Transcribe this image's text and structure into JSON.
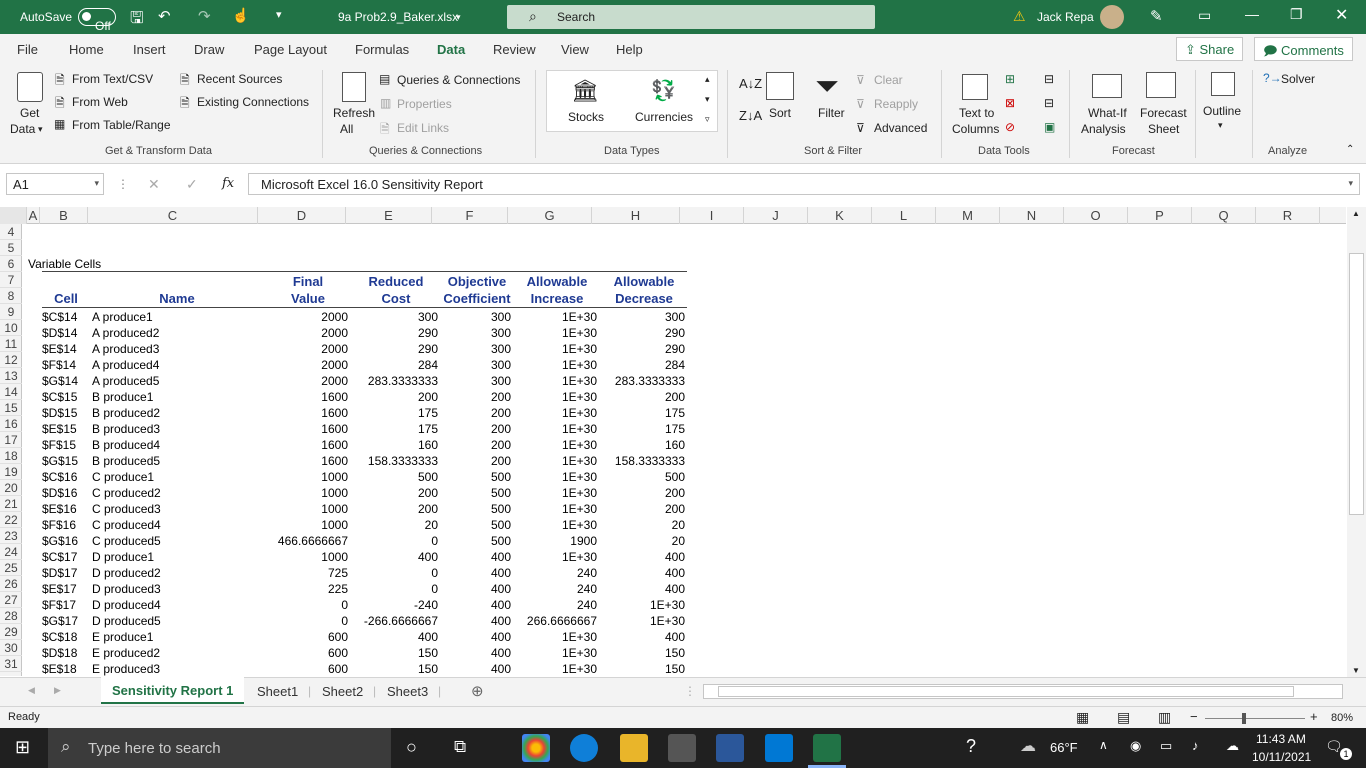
{
  "titlebar": {
    "autosave_label": "AutoSave",
    "autosave_state": "Off",
    "filename": "9a Prob2.9_Baker.xlsx",
    "search_placeholder": "Search",
    "user": "Jack Repa"
  },
  "tabs": [
    "File",
    "Home",
    "Insert",
    "Draw",
    "Page Layout",
    "Formulas",
    "Data",
    "Review",
    "View",
    "Help"
  ],
  "active_tab": "Data",
  "share_label": "Share",
  "comments_label": "Comments",
  "ribbon": {
    "get_data": "Get",
    "get_data2": "Data",
    "from_text": "From Text/CSV",
    "from_web": "From Web",
    "from_table": "From Table/Range",
    "recent_sources": "Recent Sources",
    "existing_connections": "Existing Connections",
    "group_get": "Get & Transform Data",
    "refresh": "Refresh",
    "refresh_all": "All",
    "queries_connections": "Queries & Connections",
    "properties": "Properties",
    "edit_links": "Edit Links",
    "group_queries": "Queries & Connections",
    "stocks": "Stocks",
    "currencies": "Currencies",
    "group_datatypes": "Data Types",
    "sort": "Sort",
    "filter": "Filter",
    "clear": "Clear",
    "reapply": "Reapply",
    "advanced": "Advanced",
    "group_sort": "Sort & Filter",
    "text_to": "Text to",
    "columns": "Columns",
    "group_datatools": "Data Tools",
    "whatif": "What-If",
    "analysis": "Analysis",
    "forecast": "Forecast",
    "sheet": "Sheet",
    "group_forecast": "Forecast",
    "outline": "Outline",
    "solver": "Solver",
    "group_analyze": "Analyze"
  },
  "formula_bar": {
    "name_box": "A1",
    "fx": "fx",
    "formula": "Microsoft Excel 16.0 Sensitivity Report"
  },
  "columns": [
    "A",
    "B",
    "C",
    "D",
    "E",
    "F",
    "G",
    "H",
    "I",
    "J",
    "K",
    "L",
    "M",
    "N",
    "O",
    "P",
    "Q",
    "R"
  ],
  "rows": [
    "4",
    "5",
    "6",
    "7",
    "8",
    "9",
    "10",
    "11",
    "12",
    "13",
    "14",
    "15",
    "16",
    "17",
    "18",
    "19",
    "20",
    "21",
    "22",
    "23",
    "24",
    "25",
    "26",
    "27",
    "28",
    "29",
    "30",
    "31"
  ],
  "section_label": "Variable Cells",
  "headers": {
    "cell": "Cell",
    "name": "Name",
    "final1": "Final",
    "final2": "Value",
    "reduced1": "Reduced",
    "reduced2": "Cost",
    "objective1": "Objective",
    "objective2": "Coefficient",
    "allow_inc1": "Allowable",
    "allow_inc2": "Increase",
    "allow_dec1": "Allowable",
    "allow_dec2": "Decrease"
  },
  "table": [
    [
      "$C$14",
      "A produce1",
      "2000",
      "300",
      "300",
      "1E+30",
      "300"
    ],
    [
      "$D$14",
      "A produced2",
      "2000",
      "290",
      "300",
      "1E+30",
      "290"
    ],
    [
      "$E$14",
      "A produced3",
      "2000",
      "290",
      "300",
      "1E+30",
      "290"
    ],
    [
      "$F$14",
      "A produced4",
      "2000",
      "284",
      "300",
      "1E+30",
      "284"
    ],
    [
      "$G$14",
      "A produced5",
      "2000",
      "283.3333333",
      "300",
      "1E+30",
      "283.3333333"
    ],
    [
      "$C$15",
      "B produce1",
      "1600",
      "200",
      "200",
      "1E+30",
      "200"
    ],
    [
      "$D$15",
      "B produced2",
      "1600",
      "175",
      "200",
      "1E+30",
      "175"
    ],
    [
      "$E$15",
      "B produced3",
      "1600",
      "175",
      "200",
      "1E+30",
      "175"
    ],
    [
      "$F$15",
      "B produced4",
      "1600",
      "160",
      "200",
      "1E+30",
      "160"
    ],
    [
      "$G$15",
      "B produced5",
      "1600",
      "158.3333333",
      "200",
      "1E+30",
      "158.3333333"
    ],
    [
      "$C$16",
      "C produce1",
      "1000",
      "500",
      "500",
      "1E+30",
      "500"
    ],
    [
      "$D$16",
      "C produced2",
      "1000",
      "200",
      "500",
      "1E+30",
      "200"
    ],
    [
      "$E$16",
      "C produced3",
      "1000",
      "200",
      "500",
      "1E+30",
      "200"
    ],
    [
      "$F$16",
      "C produced4",
      "1000",
      "20",
      "500",
      "1E+30",
      "20"
    ],
    [
      "$G$16",
      "C produced5",
      "466.6666667",
      "0",
      "500",
      "1900",
      "20"
    ],
    [
      "$C$17",
      "D produce1",
      "1000",
      "400",
      "400",
      "1E+30",
      "400"
    ],
    [
      "$D$17",
      "D produced2",
      "725",
      "0",
      "400",
      "240",
      "400"
    ],
    [
      "$E$17",
      "D produced3",
      "225",
      "0",
      "400",
      "240",
      "400"
    ],
    [
      "$F$17",
      "D produced4",
      "0",
      "-240",
      "400",
      "240",
      "1E+30"
    ],
    [
      "$G$17",
      "D produced5",
      "0",
      "-266.6666667",
      "400",
      "266.6666667",
      "1E+30"
    ],
    [
      "$C$18",
      "E produce1",
      "600",
      "400",
      "400",
      "1E+30",
      "400"
    ],
    [
      "$D$18",
      "E produced2",
      "600",
      "150",
      "400",
      "1E+30",
      "150"
    ],
    [
      "$E$18",
      "E produced3",
      "600",
      "150",
      "400",
      "1E+30",
      "150"
    ]
  ],
  "sheet_tabs": [
    "Sensitivity Report 1",
    "Sheet1",
    "Sheet2",
    "Sheet3"
  ],
  "active_sheet": "Sensitivity Report 1",
  "status": {
    "ready": "Ready",
    "zoom": "80%"
  },
  "taskbar": {
    "search_placeholder": "Type here to search",
    "weather": "66°F",
    "time": "11:43 AM",
    "date": "10/11/2021",
    "notifications": "1"
  }
}
